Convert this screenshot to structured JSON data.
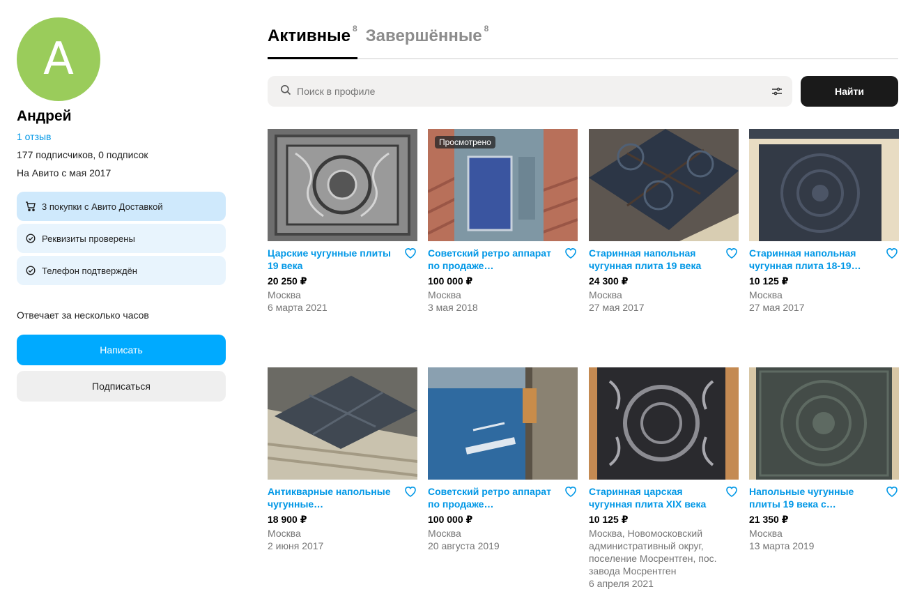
{
  "profile": {
    "avatar_letter": "А",
    "name": "Андрей",
    "reviews": "1 отзыв",
    "followers": "177 подписчиков, 0 подписок",
    "since": "На Авито с мая 2017",
    "badges": [
      {
        "icon": "cart-icon",
        "text": "3 покупки с Авито Доставкой"
      },
      {
        "icon": "check-circle-icon",
        "text": "Реквизиты проверены"
      },
      {
        "icon": "check-circle-icon",
        "text": "Телефон подтверждён"
      }
    ],
    "answer_time": "Отвечает за несколько часов",
    "write_label": "Написать",
    "subscribe_label": "Подписаться"
  },
  "tabs": [
    {
      "label": "Активные",
      "count": "8"
    },
    {
      "label": "Завершённые",
      "count": "8"
    }
  ],
  "search": {
    "placeholder": "Поиск в профиле",
    "button_label": "Найти"
  },
  "viewed_label": "Просмотрено",
  "colors": {
    "accent": "#00aaff",
    "link": "#0097e6",
    "avatar": "#9acc5b"
  },
  "items": [
    {
      "title": "Царские чугунные плиты 19 века",
      "price": "20 250 ₽",
      "location": "Москва",
      "date": "6 марта 2021"
    },
    {
      "title": "Советский ретро аппарат по продаже…",
      "price": "100 000 ₽",
      "location": "Москва",
      "date": "3 мая 2018",
      "viewed": true
    },
    {
      "title": "Старинная напольная чугунная плита 19 века",
      "price": "24 300 ₽",
      "location": "Москва",
      "date": "27 мая 2017"
    },
    {
      "title": "Старинная напольная чугунная плита 18-19…",
      "price": "10 125 ₽",
      "location": "Москва",
      "date": "27 мая 2017"
    },
    {
      "title": "Антикварные напольные чугунные…",
      "price": "18 900 ₽",
      "location": "Москва",
      "date": "2 июня 2017"
    },
    {
      "title": "Советский ретро аппарат по продаже…",
      "price": "100 000 ₽",
      "location": "Москва",
      "date": "20 августа 2019"
    },
    {
      "title": "Старинная царская чугунная плита XIX века",
      "price": "10 125 ₽",
      "location": "Москва, Новомосковский административный округ, поселение Мосрентген, пос. завода Мосрентген",
      "date": "6 апреля 2021"
    },
    {
      "title": "Напольные чугунные плиты 19 века с…",
      "price": "21 350 ₽",
      "location": "Москва",
      "date": "13 марта 2019"
    }
  ]
}
